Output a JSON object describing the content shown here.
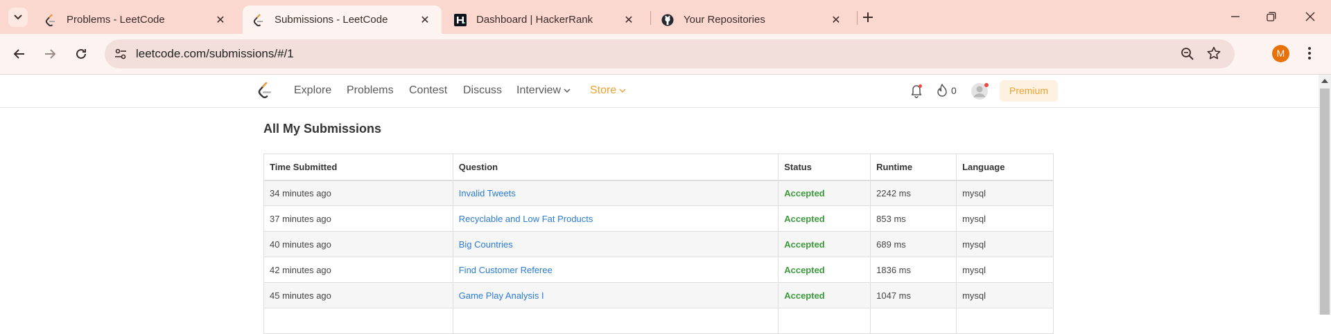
{
  "browser": {
    "tabs": [
      {
        "title": "Problems - LeetCode",
        "favicon": "leetcode-icon",
        "active": false
      },
      {
        "title": "Submissions - LeetCode",
        "favicon": "leetcode-icon",
        "active": true
      },
      {
        "title": "Dashboard | HackerRank",
        "favicon": "hackerrank-icon",
        "active": false
      },
      {
        "title": "Your Repositories",
        "favicon": "github-icon",
        "active": false
      }
    ],
    "url": "leetcode.com/submissions/#/1",
    "profile_initial": "M",
    "profile_color": "#e8710a"
  },
  "leetcode_nav": {
    "links": [
      "Explore",
      "Problems",
      "Contest",
      "Discuss",
      "Interview",
      "Store"
    ],
    "streak_count": "0",
    "premium_label": "Premium",
    "accent_color": "#f0a030"
  },
  "main": {
    "heading": "All My Submissions",
    "columns": [
      "Time Submitted",
      "Question",
      "Status",
      "Runtime",
      "Language"
    ],
    "rows": [
      {
        "time": "34 minutes ago",
        "question": "Invalid Tweets",
        "status": "Accepted",
        "runtime": "2242 ms",
        "language": "mysql"
      },
      {
        "time": "37 minutes ago",
        "question": "Recyclable and Low Fat Products",
        "status": "Accepted",
        "runtime": "853 ms",
        "language": "mysql"
      },
      {
        "time": "40 minutes ago",
        "question": "Big Countries",
        "status": "Accepted",
        "runtime": "689 ms",
        "language": "mysql"
      },
      {
        "time": "42 minutes ago",
        "question": "Find Customer Referee",
        "status": "Accepted",
        "runtime": "1836 ms",
        "language": "mysql"
      },
      {
        "time": "45 minutes ago",
        "question": "Game Play Analysis I",
        "status": "Accepted",
        "runtime": "1047 ms",
        "language": "mysql"
      }
    ],
    "status_color": "#3c9a3c",
    "link_color": "#2a7bd6"
  }
}
